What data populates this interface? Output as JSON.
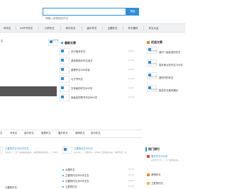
{
  "search": {
    "placeholder": "请输入您想找的作文",
    "button_label": "搜索"
  },
  "nav": [
    {
      "label": "写作文"
    },
    {
      "label": "24节气作文"
    },
    {
      "label": "小学作文"
    },
    {
      "label": "初中作文"
    },
    {
      "label": "高中作文"
    },
    {
      "label": "主题作文"
    },
    {
      "label": "作文素材"
    },
    {
      "label": "作文大全"
    }
  ],
  "slideshow": {
    "caption": "文",
    "thumb_caption": "学作文"
  },
  "latest": {
    "title": "最新文章",
    "items": [
      {
        "text": "关于描写作文",
        "date": "12-17"
      },
      {
        "text": "游戏的快乐作文范文",
        "date": "12-17"
      },
      {
        "text": "感恩作文500字高",
        "date": "12-17"
      },
      {
        "text": "七夕节作文",
        "date": "12-17"
      },
      {
        "text": "五年级的作文400字",
        "date": "12-17"
      },
      {
        "text": "我喜欢的季节作文600字",
        "date": "12-17"
      }
    ]
  },
  "recommended": {
    "title": "优选文章",
    "items": [
      {
        "thumb": "我们学作文",
        "text": "我们一起走进的作文"
      },
      {
        "thumb": "家乡作文",
        "text": "描写家乡的作文700字"
      },
      {
        "thumb": "重阳节作文",
        "text": "重阳节的作文"
      },
      {
        "thumb": "作文素材",
        "text": "励志作文素材摘抄"
      }
    ]
  },
  "tabs": [
    {
      "label": "文"
    },
    {
      "label": "写作文"
    },
    {
      "label": "高中作文"
    },
    {
      "label": "感恩作文"
    },
    {
      "label": "春分作文"
    },
    {
      "label": "清明作文"
    },
    {
      "label": "初中作文"
    }
  ],
  "list": {
    "col1": [
      {
        "title": "立春的作文300字左右",
        "desc": "立春到了，天气变得暖和起来，路边的柳树发芽了，小草也钻出了地面"
      },
      {
        "title": "立春的作文",
        "desc": ""
      }
    ],
    "col2": [
      {
        "title": "立春的作文300字",
        "desc": "春天来了，万物复苏，小草从土里探出头来，柳树长出了嫩芽"
      },
      {
        "text": "大雪作文",
        "date": "12-17"
      },
      {
        "text": "立春的作文400字左右",
        "date": "12-17"
      },
      {
        "text": "立春的作文300字左右",
        "date": "12-17"
      },
      {
        "text": "立夏的作文",
        "date": "12-17"
      }
    ]
  },
  "hot": {
    "title": "热门排行",
    "items": [
      {
        "text": "春分作文300字",
        "desc": "春分时节到了，天气暖和起来。"
      },
      {
        "text": "清明作文",
        "desc": ""
      },
      {
        "text": "立夏的作文",
        "desc": ""
      }
    ]
  },
  "colors": {
    "accent": "#2e8fd6",
    "hot": "#f0892b"
  }
}
